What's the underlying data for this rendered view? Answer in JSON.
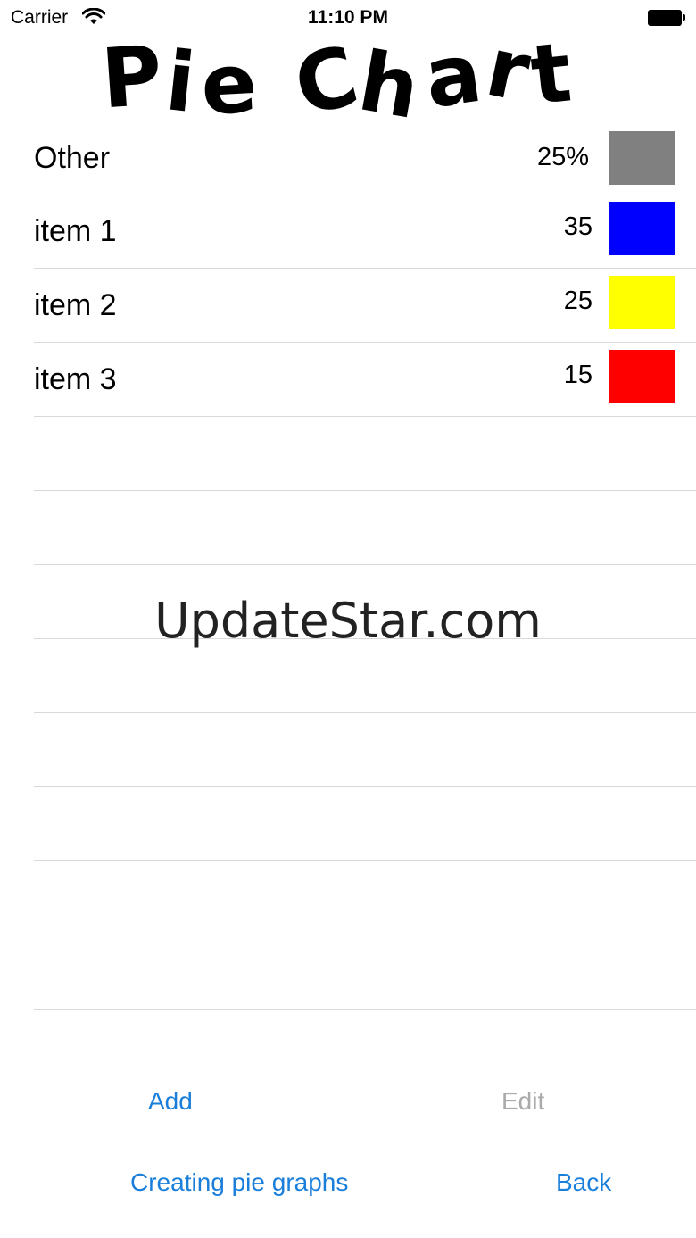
{
  "status": {
    "carrier": "Carrier",
    "time": "11:10 PM"
  },
  "title": {
    "chars": [
      "P",
      "i",
      "e",
      " ",
      "C",
      "h",
      "a",
      "r",
      "t"
    ]
  },
  "rows": [
    {
      "label": "Other",
      "value": "25%",
      "color": "#808080"
    },
    {
      "label": "item 1",
      "value": "35",
      "color": "#0000ff"
    },
    {
      "label": "item 2",
      "value": "25",
      "color": "#ffff00"
    },
    {
      "label": "item 3",
      "value": "15",
      "color": "#ff0000"
    }
  ],
  "watermark": "UpdateStar.com",
  "buttons": {
    "add": "Add",
    "edit": "Edit",
    "create": "Creating pie graphs",
    "back": "Back"
  }
}
